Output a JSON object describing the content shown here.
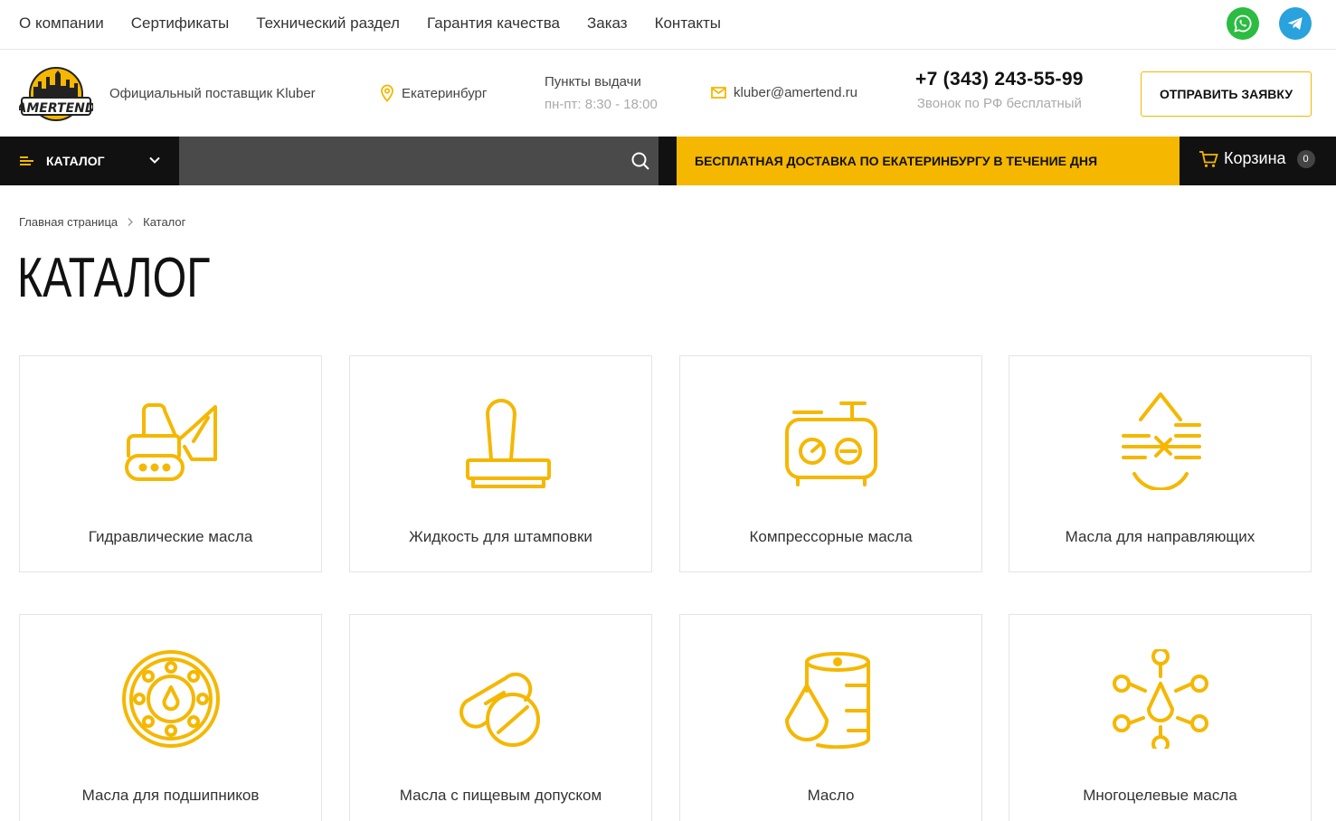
{
  "topnav": {
    "links": [
      "О компании",
      "Сертификаты",
      "Технический раздел",
      "Гарантия качества",
      "Заказ",
      "Контакты"
    ]
  },
  "header": {
    "logo_text": "AMERTEND",
    "supplier": "Официальный поставщик Kluber",
    "city": "Екатеринбург",
    "pickup_title": "Пункты выдачи",
    "pickup_hours": "пн-пт: 8:30 - 18:00",
    "email": "kluber@amertend.ru",
    "phone": "+7 (343) 243-55-99",
    "phone_note": "Звонок по РФ бесплатный",
    "request_button": "ОТПРАВИТЬ ЗАЯВКУ"
  },
  "bar": {
    "catalog_label": "КАТАЛОГ",
    "search_placeholder": "",
    "promo": "БЕСПЛАТНАЯ ДОСТАВКА ПО ЕКАТЕРИНБУРГУ В ТЕЧЕНИЕ ДНЯ",
    "cart_label": "Корзина",
    "cart_count": "0"
  },
  "breadcrumb": {
    "home": "Главная страница",
    "current": "Каталог"
  },
  "page_title": "КАТАЛОГ",
  "colors": {
    "accent": "#f5b700",
    "dark": "#111111",
    "search_bg": "#4a4a4a",
    "whatsapp": "#2cbc42",
    "telegram": "#29a2dd"
  },
  "categories": [
    {
      "name": "Гидравлические масла",
      "icon": "excavator-icon"
    },
    {
      "name": "Жидкость для штамповки",
      "icon": "stamp-icon"
    },
    {
      "name": "Компрессорные масла",
      "icon": "compressor-icon"
    },
    {
      "name": "Масла для направляющих",
      "icon": "drop-arrows-icon"
    },
    {
      "name": "Масла для подшипников",
      "icon": "bearing-icon"
    },
    {
      "name": "Масла с пищевым допуском",
      "icon": "pill-icon"
    },
    {
      "name": "Масло",
      "icon": "barrel-drop-icon"
    },
    {
      "name": "Многоцелевые масла",
      "icon": "drop-network-icon"
    }
  ]
}
